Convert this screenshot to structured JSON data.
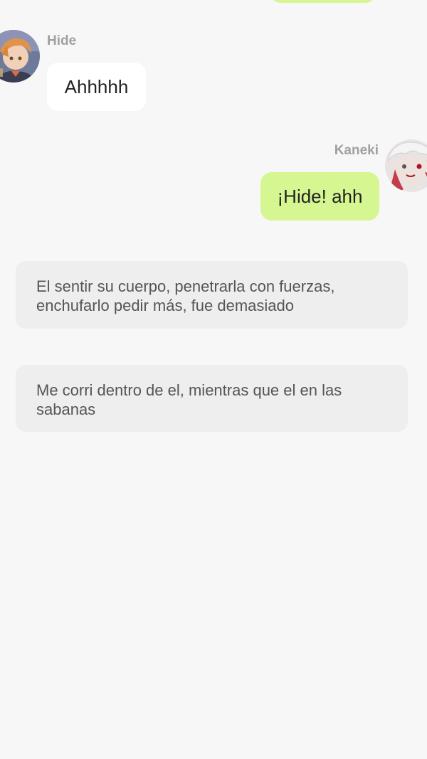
{
  "chat": {
    "messages": [
      {
        "sender": "Hide",
        "text": "Ahhhhh",
        "side": "left",
        "avatar_icon": "hide-avatar",
        "bubble_color": "#ffffff"
      },
      {
        "sender": "Kaneki",
        "text": "¡Hide! ahh",
        "side": "right",
        "avatar_icon": "kaneki-avatar",
        "bubble_color": "#d6f691"
      }
    ],
    "narrations": [
      {
        "text": "El sentir su cuerpo, penetrarla con fuerzas, enchufarlo pedir más, fue demasiado"
      },
      {
        "text": "Me corri dentro de el, mientras que el en las sabanas"
      }
    ]
  },
  "colors": {
    "background": "#f7f7f7",
    "own_bubble": "#d6f691",
    "other_bubble": "#ffffff",
    "narration_bubble": "#eeeeee",
    "sender_name": "#a0a0a0"
  }
}
